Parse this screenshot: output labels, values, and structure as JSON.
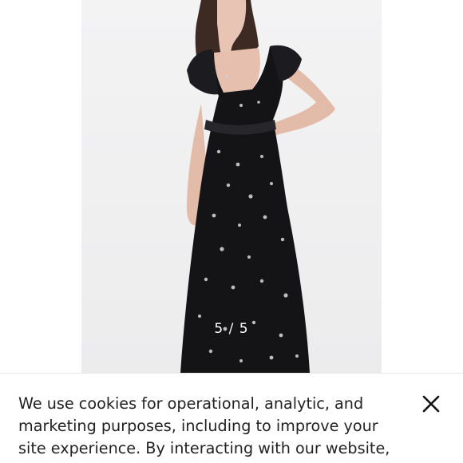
{
  "gallery": {
    "photo_alt": "Black floral ruffle midi dress",
    "counter": "5 / 5"
  },
  "cookie_banner": {
    "text": "We use cookies for operational, analytic, and marketing purposes, including to improve your site experience. By interacting with our website, you",
    "close_icon": "close-icon"
  },
  "colors": {
    "dress": "#141416",
    "background": "#f1f1f2",
    "text": "#222222"
  }
}
